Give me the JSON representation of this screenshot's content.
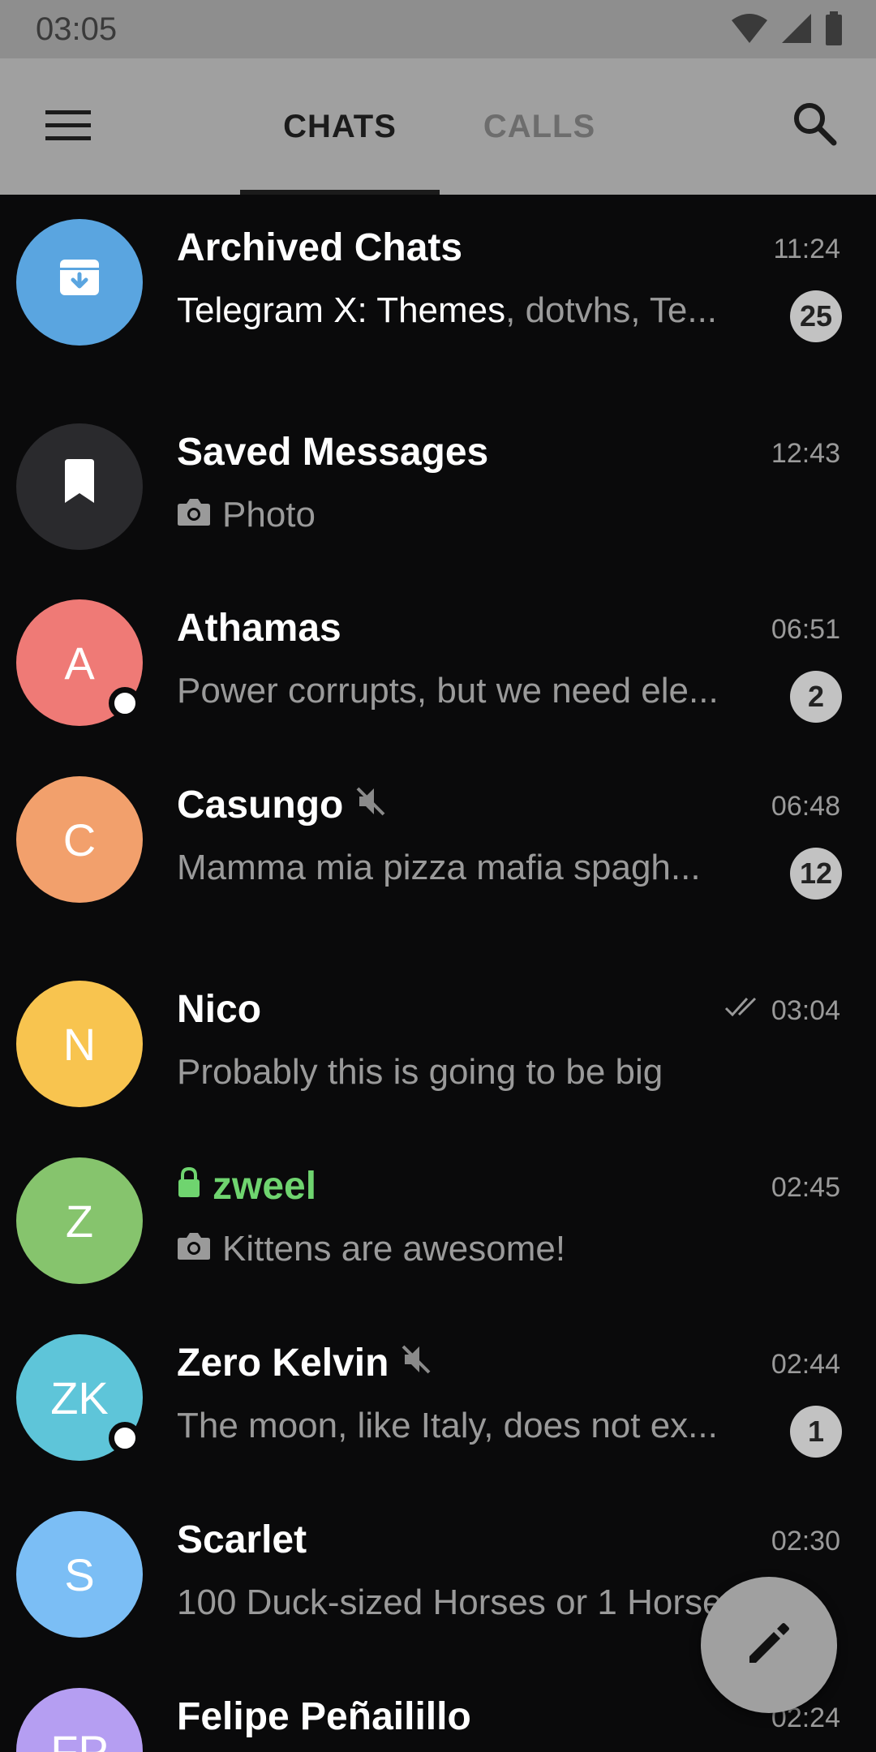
{
  "status_bar": {
    "time": "03:05"
  },
  "header": {
    "tabs": [
      {
        "label": "CHATS",
        "active": true
      },
      {
        "label": "CALLS",
        "active": false
      }
    ]
  },
  "colors": {
    "background": "#0a0a0b",
    "header": "#a0a0a0",
    "secure_green": "#6fd46f"
  },
  "chats": [
    {
      "title": "Archived Chats",
      "time": "11:24",
      "preview_strong": "Telegram X: Themes",
      "preview": ", dotvhs, Te...",
      "badge": "25",
      "avatar_icon": "archive-icon",
      "avatar_color": "#5aa5e0"
    },
    {
      "title": "Saved Messages",
      "time": "12:43",
      "preview": "Photo",
      "preview_icon": "camera-icon",
      "avatar_icon": "bookmark-icon",
      "avatar_color": "#2a2a2d"
    },
    {
      "title": "Athamas",
      "time": "06:51",
      "preview": "Power corrupts, but we need ele...",
      "badge": "2",
      "initials": "A",
      "avatar_color": "#ef7a76",
      "online": true
    },
    {
      "title": "Casungo",
      "time": "06:48",
      "preview": "Mamma mia pizza mafia spagh...",
      "badge": "12",
      "initials": "C",
      "avatar_color": "#f2a06c",
      "muted": true
    },
    {
      "title": "Nico",
      "time": "03:04",
      "preview": "Probably this is going to be big",
      "initials": "N",
      "avatar_color": "#f8c44f",
      "read": true
    },
    {
      "title": "zweel",
      "time": "02:45",
      "preview": "Kittens are awesome!",
      "preview_icon": "camera-icon",
      "initials": "Z",
      "avatar_color": "#86c46d",
      "secret": true
    },
    {
      "title": "Zero Kelvin",
      "time": "02:44",
      "preview": "The moon, like Italy, does not ex...",
      "badge": "1",
      "initials": "ZK",
      "avatar_color": "#5ec5d9",
      "muted": true,
      "online": true
    },
    {
      "title": "Scarlet",
      "time": "02:30",
      "preview": "100 Duck-sized Horses or 1 Horse",
      "initials": "S",
      "avatar_color": "#7bbef5"
    },
    {
      "title": "Felipe Peñailillo",
      "time": "02:24",
      "preview": "",
      "initials": "FP",
      "avatar_color": "#b59ef2"
    }
  ]
}
